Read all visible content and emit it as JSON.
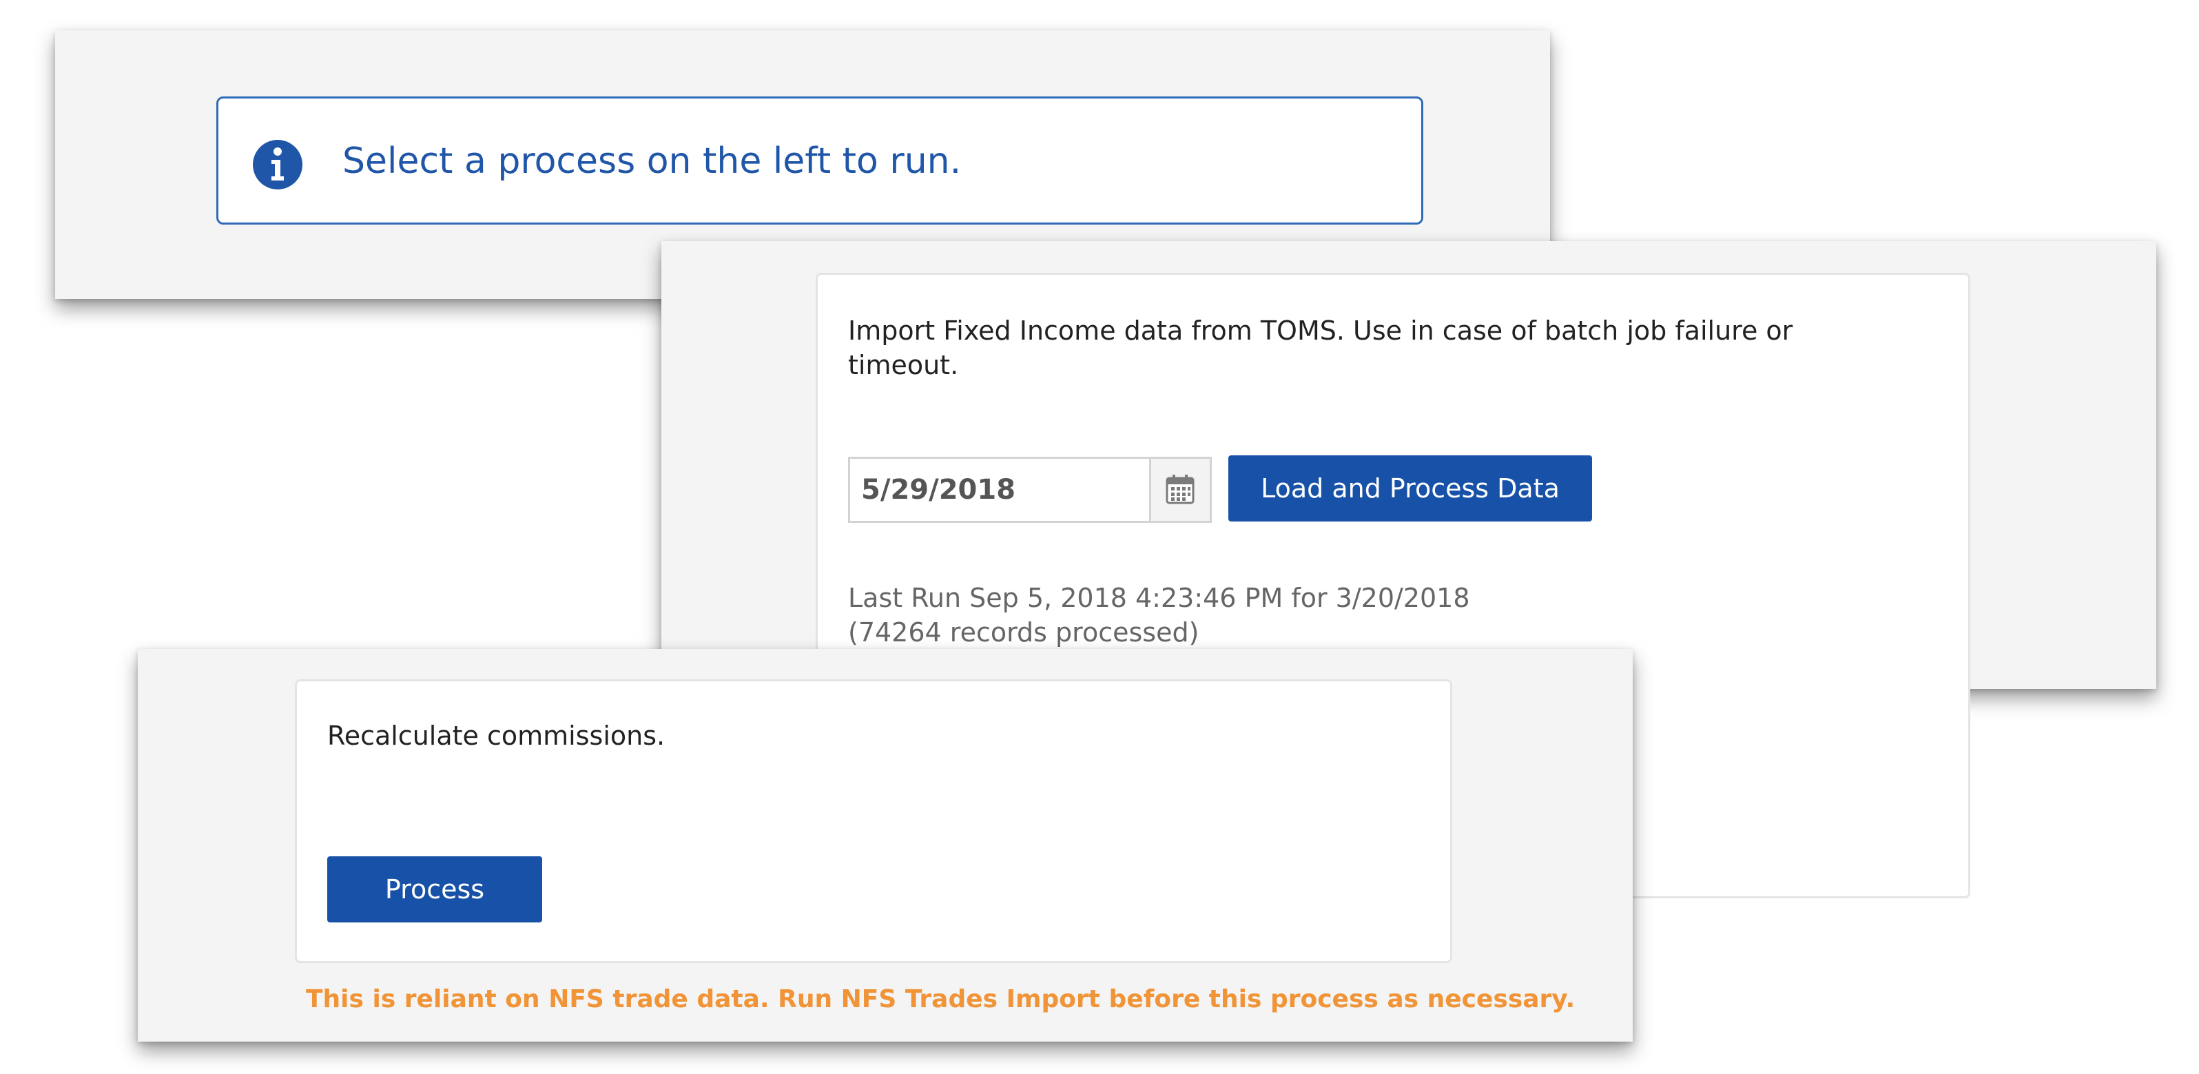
{
  "info_panel": {
    "message": "Select a process on the left to run.",
    "icon": "info-circle-icon",
    "accent_color": "#1f56a8"
  },
  "import_panel": {
    "description": "Import Fixed Income data from TOMS. Use in case of batch job failure or timeout.",
    "date_value": "5/29/2018",
    "calendar_icon": "calendar-icon",
    "button_label": "Load and Process Data",
    "last_run_line1": "Last Run Sep 5, 2018 4:23:46 PM for 3/20/2018",
    "last_run_line2": "(74264 records processed)"
  },
  "recalc_panel": {
    "description": "Recalculate commissions.",
    "button_label": "Process",
    "warning": "This is reliant on NFS trade data. Run NFS Trades Import before this process as necessary.",
    "warning_color": "#f09437"
  },
  "colors": {
    "primary_button": "#1752a8",
    "panel_background": "#f4f4f4",
    "alert_border": "#2f6bb8"
  }
}
